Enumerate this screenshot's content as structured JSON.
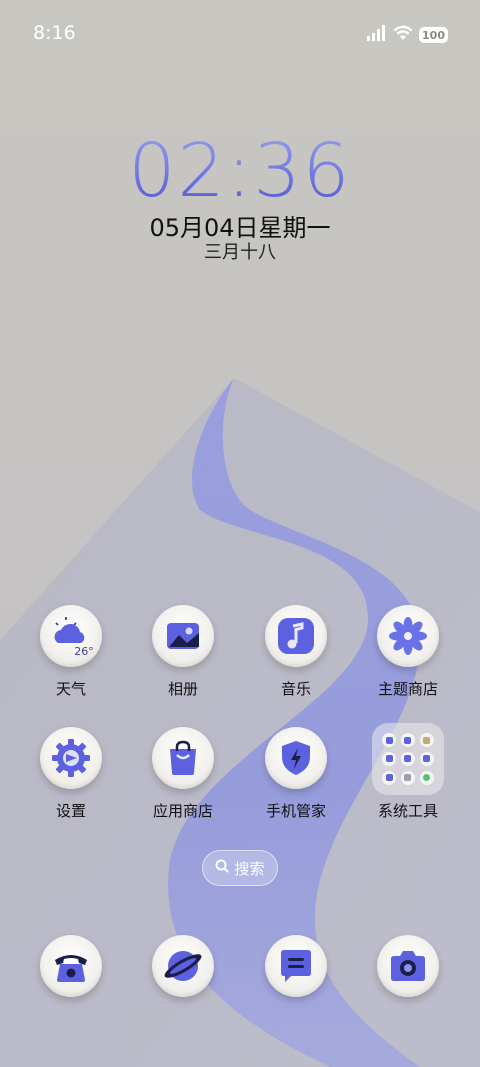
{
  "status_bar": {
    "time": "8:16",
    "battery": "100",
    "icons": [
      "signal-icon",
      "wifi-icon",
      "battery-icon"
    ]
  },
  "clock": {
    "time": "02:36",
    "date": "05月04日星期一",
    "lunar": "三月十八"
  },
  "apps_row1": [
    {
      "label": "天气",
      "icon": "weather-icon",
      "temp": "26°"
    },
    {
      "label": "相册",
      "icon": "gallery-icon"
    },
    {
      "label": "音乐",
      "icon": "music-icon"
    },
    {
      "label": "主题商店",
      "icon": "theme-store-icon"
    }
  ],
  "apps_row2": [
    {
      "label": "设置",
      "icon": "gear-icon"
    },
    {
      "label": "应用商店",
      "icon": "app-store-icon"
    },
    {
      "label": "手机管家",
      "icon": "phone-manager-icon"
    },
    {
      "label": "系统工具",
      "icon": "folder-icon"
    }
  ],
  "search": {
    "label": "搜索"
  },
  "dock": [
    {
      "icon": "phone-icon"
    },
    {
      "icon": "browser-icon"
    },
    {
      "icon": "messages-icon"
    },
    {
      "icon": "camera-icon"
    }
  ],
  "colors": {
    "accent": "#5a60df",
    "background": "#c8c6c0",
    "wave": "#8f95e4"
  }
}
